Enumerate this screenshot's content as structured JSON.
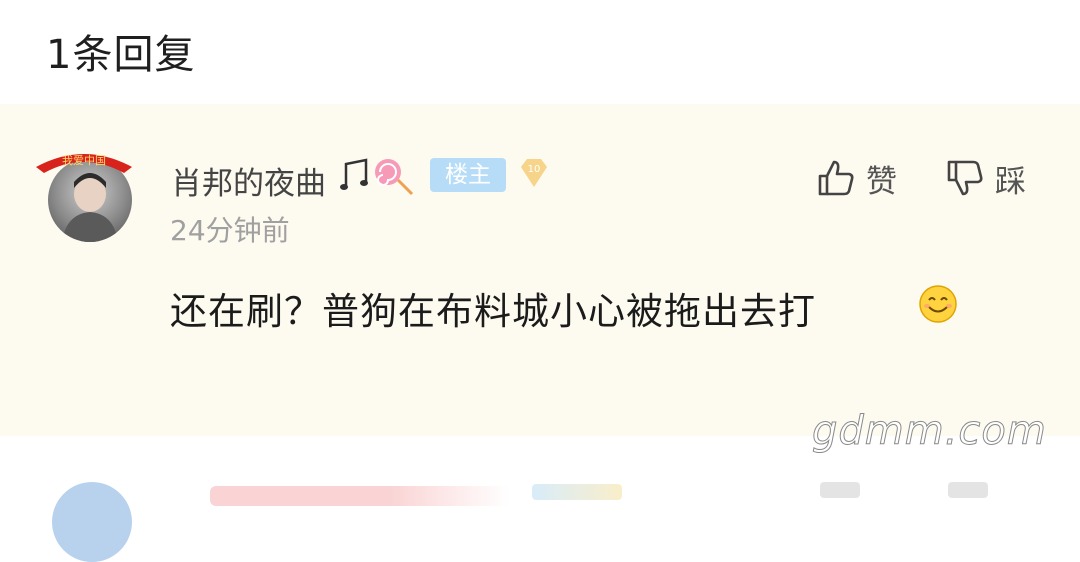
{
  "header": {
    "title": "1条回复"
  },
  "comment": {
    "username": "肖邦的夜曲",
    "owner_badge": "楼主",
    "level": "10",
    "timestamp": "24分钟前",
    "text": "还在刷？普狗在布料城小心被拖出去打",
    "like_label": "赞",
    "dislike_label": "踩",
    "avatar_banner_text": "我爱中国"
  },
  "watermark": {
    "text": "gdmm.com"
  },
  "colors": {
    "card_bg": "#fdfaf0",
    "owner_badge_bg": "#b7dcf7",
    "level_badge": "#f6d48a",
    "timestamp": "#a0a0a0"
  },
  "icons": [
    "thumbs-up-icon",
    "thumbs-down-icon",
    "music-note-icon",
    "lollipop-icon",
    "smiley-emoji-icon",
    "diamond-level-icon"
  ]
}
